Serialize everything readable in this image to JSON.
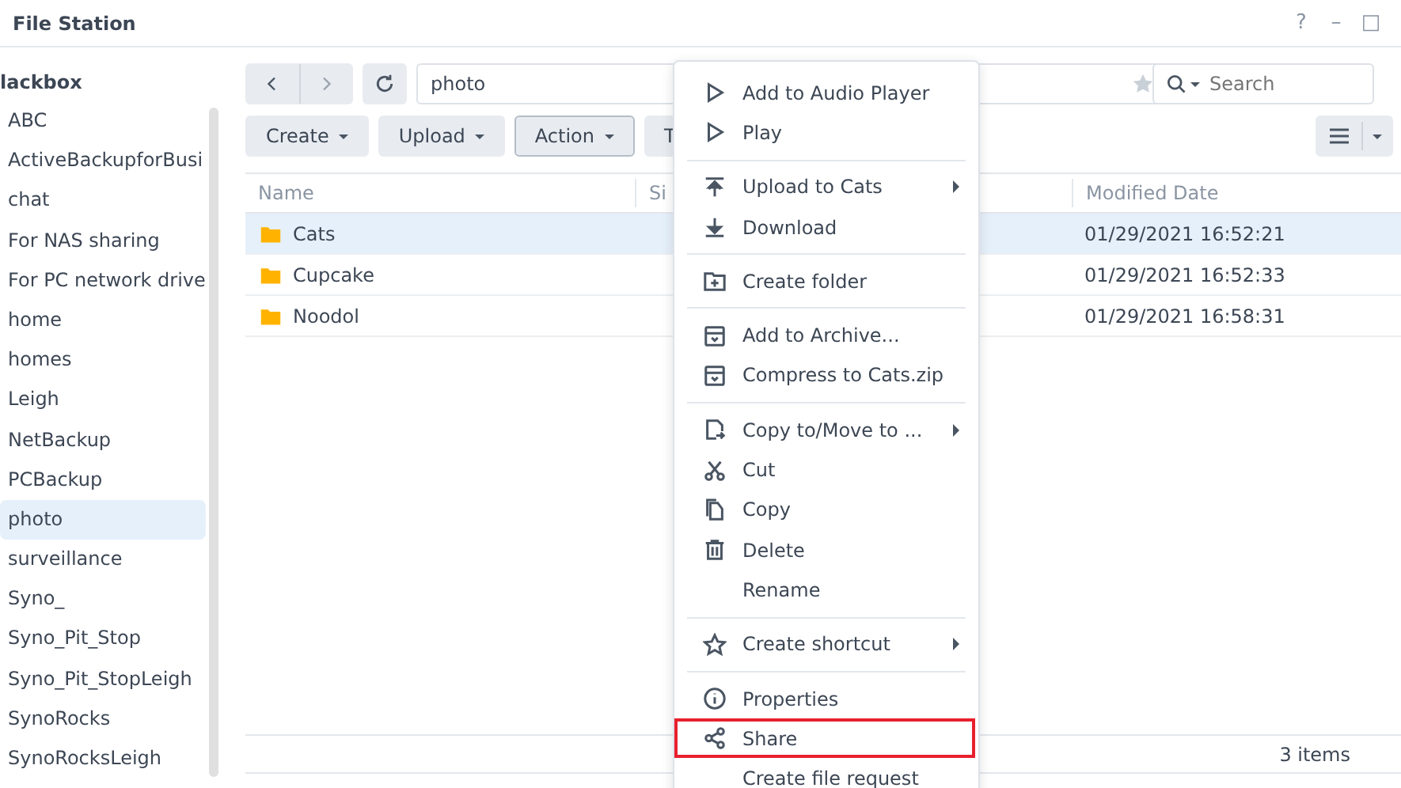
{
  "window": {
    "title": "File Station",
    "controls": [
      "?",
      "–",
      "□"
    ]
  },
  "sidebar": {
    "root": "lackbox",
    "items": [
      {
        "label": "ABC",
        "selected": false
      },
      {
        "label": "ActiveBackupforBusi",
        "selected": false
      },
      {
        "label": "chat",
        "selected": false
      },
      {
        "label": "For NAS sharing",
        "selected": false
      },
      {
        "label": "For PC network drive",
        "selected": false
      },
      {
        "label": "home",
        "selected": false
      },
      {
        "label": "homes",
        "selected": false
      },
      {
        "label": "Leigh",
        "selected": false
      },
      {
        "label": "NetBackup",
        "selected": false
      },
      {
        "label": "PCBackup",
        "selected": false
      },
      {
        "label": "photo",
        "selected": true
      },
      {
        "label": "surveillance",
        "selected": false
      },
      {
        "label": "Syno_",
        "selected": false
      },
      {
        "label": "Syno_Pit_Stop",
        "selected": false
      },
      {
        "label": "Syno_Pit_StopLeigh",
        "selected": false
      },
      {
        "label": "SynoRocks",
        "selected": false
      },
      {
        "label": "SynoRocksLeigh",
        "selected": false
      }
    ]
  },
  "path": {
    "value": "photo"
  },
  "search": {
    "placeholder": "Search"
  },
  "actions": [
    {
      "label": "Create",
      "selected": false
    },
    {
      "label": "Upload",
      "selected": false
    },
    {
      "label": "Action",
      "selected": true
    },
    {
      "label": "T",
      "selected": false
    }
  ],
  "table": {
    "columns": [
      "Name",
      "Si",
      "Modified Date"
    ],
    "rows": [
      {
        "name": "Cats",
        "modified": "01/29/2021 16:52:21",
        "selected": true
      },
      {
        "name": "Cupcake",
        "modified": "01/29/2021 16:52:33",
        "selected": false
      },
      {
        "name": "Noodol",
        "modified": "01/29/2021 16:58:31",
        "selected": false
      }
    ]
  },
  "status_bar": {
    "count": "3 items"
  },
  "context_menu": {
    "groups": [
      [
        {
          "label": "Add to Audio Player",
          "submenu": false,
          "highlighted": false
        },
        {
          "label": "Play",
          "submenu": false,
          "highlighted": false
        }
      ],
      [
        {
          "label": "Upload to Cats",
          "submenu": true,
          "highlighted": false
        },
        {
          "label": "Download",
          "submenu": false,
          "highlighted": false
        }
      ],
      [
        {
          "label": "Create folder",
          "submenu": false,
          "highlighted": false
        }
      ],
      [
        {
          "label": "Add to Archive...",
          "submenu": false,
          "highlighted": false
        },
        {
          "label": "Compress to Cats.zip",
          "submenu": false,
          "highlighted": false
        }
      ],
      [
        {
          "label": "Copy to/Move to ...",
          "submenu": true,
          "highlighted": false
        },
        {
          "label": "Cut",
          "submenu": false,
          "highlighted": false
        },
        {
          "label": "Copy",
          "submenu": false,
          "highlighted": false
        },
        {
          "label": "Delete",
          "submenu": false,
          "highlighted": false
        },
        {
          "label": "Rename",
          "submenu": false,
          "highlighted": false
        }
      ],
      [
        {
          "label": "Create shortcut",
          "submenu": true,
          "highlighted": false
        }
      ],
      [
        {
          "label": "Properties",
          "submenu": false,
          "highlighted": false
        },
        {
          "label": "Share",
          "submenu": false,
          "highlighted": true
        },
        {
          "label": "Create file request",
          "submenu": false,
          "highlighted": false
        }
      ]
    ]
  }
}
